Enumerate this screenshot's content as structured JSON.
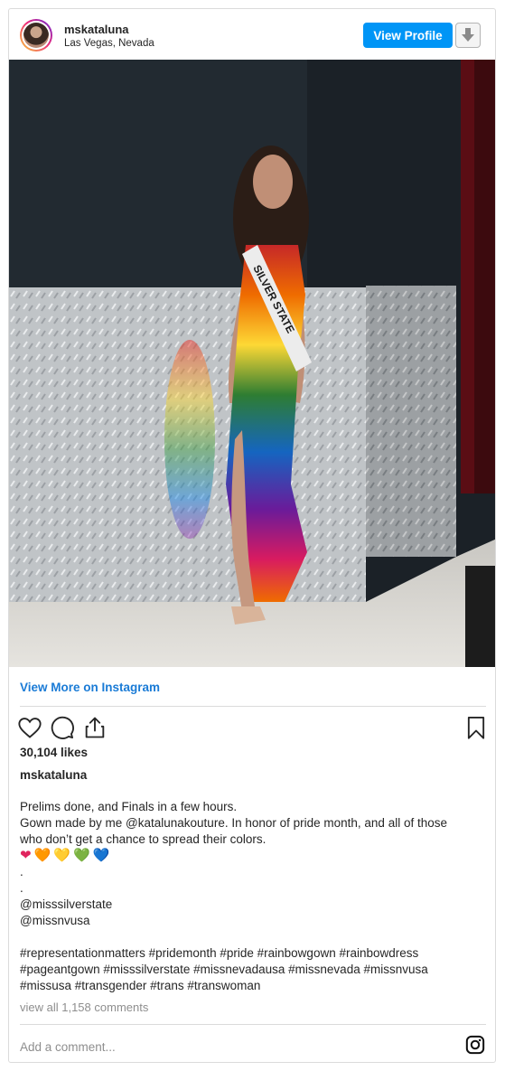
{
  "header": {
    "username": "mskataluna",
    "location": "Las Vegas, Nevada",
    "view_profile_label": "View Profile"
  },
  "photo": {
    "sash_text": "SILVER STATE"
  },
  "links": {
    "view_more": "View More on Instagram"
  },
  "stats": {
    "likes": "30,104 likes"
  },
  "caption": {
    "username": "mskataluna",
    "lines": [
      "Prelims done, and Finals in a few hours.",
      "Gown made by me @katalunakouture. In honor of pride month, and all of those",
      "who don’t get a chance to spread their colors."
    ],
    "hearts": [
      "❤",
      "🧡",
      "💛",
      "💚",
      "💙"
    ],
    "heart_colors": [
      "#e0245e",
      "#f4900c",
      "#ffcc4d",
      "#77b255",
      "#1d8de2"
    ],
    "dots": [
      ".",
      "."
    ],
    "mentions": [
      "@misssilverstate",
      "@missnvusa"
    ],
    "hashtag_lines": [
      "#representationmatters #pridemonth #pride #rainbowgown #rainbowdress",
      "#pageantgown #misssilverstate #missnevadausa #missnevada #missnvusa",
      "#missusa #transgender #trans #transwoman"
    ]
  },
  "comments": {
    "view_all": "view all 1,158 comments",
    "placeholder": "Add a comment..."
  },
  "colors": {
    "accent_blue": "#0095f6",
    "link_blue": "#1a7bd6",
    "text": "#262626",
    "muted": "#8e8e8e",
    "border": "#dbdbdb"
  },
  "icons": {
    "like": "heart-icon",
    "comment": "comment-icon",
    "share": "share-icon",
    "save": "bookmark-icon",
    "download": "download-arrow-icon",
    "instagram": "instagram-icon"
  }
}
